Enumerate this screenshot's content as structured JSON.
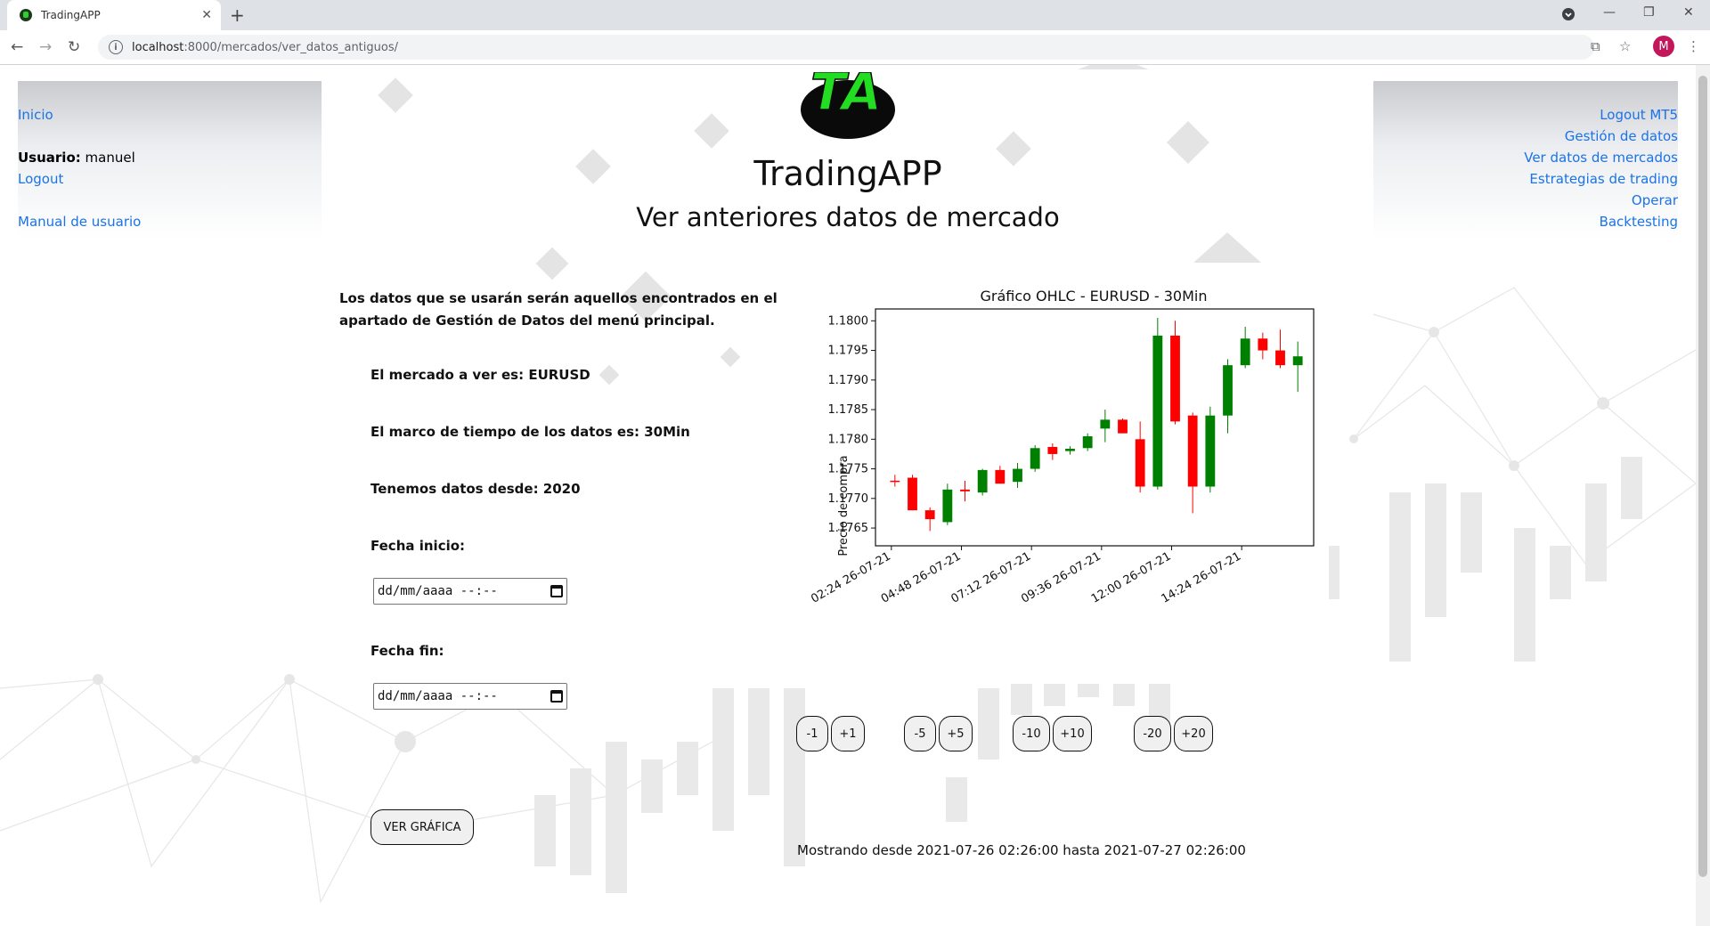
{
  "browser": {
    "tab_title": "TradingAPP",
    "url_host": "localhost",
    "url_path": ":8000/mercados/ver_datos_antiguos/",
    "profile_initial": "M"
  },
  "left_nav": {
    "inicio": "Inicio",
    "user_label": "Usuario:",
    "user_name": "manuel",
    "logout": "Logout",
    "manual": "Manual de usuario"
  },
  "right_nav": [
    "Logout MT5",
    "Gestión de datos",
    "Ver datos de mercados",
    "Estrategias de trading",
    "Operar",
    "Backtesting"
  ],
  "logo_text": "TA",
  "app_title": "TradingAPP",
  "page_title": "Ver anteriores datos de mercado",
  "description": "Los datos que se usarán serán aquellos encontrados en el apartado de Gestión de Datos del menú principal.",
  "info": {
    "market": "El mercado a ver es: EURUSD",
    "timeframe": "El marco de tiempo de los datos es: 30Min",
    "since": "Tenemos datos desde: 2020",
    "start_label": "Fecha inicio:",
    "end_label": "Fecha fin:",
    "date_placeholder": "dd/mm/aaaa --:--"
  },
  "buttons": {
    "m1": "-1",
    "p1": "+1",
    "m5": "-5",
    "p5": "+5",
    "m10": "-10",
    "p10": "+10",
    "m20": "-20",
    "p20": "+20",
    "view_chart": "VER GRÁFICA"
  },
  "status_text": "Mostrando desde 2021-07-26 02:26:00 hasta 2021-07-27 02:26:00",
  "colors": {
    "link": "#1a73e8",
    "up": "#008000",
    "down": "#ff0000",
    "logo_green": "#22dd22"
  },
  "chart_data": {
    "type": "candlestick",
    "title": "Gráfico OHLC - EURUSD - 30Min",
    "ylabel": "Precio de compra",
    "xlabel": "",
    "ylim": [
      1.1762,
      1.1802
    ],
    "y_ticks": [
      1.1765,
      1.177,
      1.1775,
      1.178,
      1.1785,
      1.179,
      1.1795,
      1.18
    ],
    "x_ticks": [
      "02:24  26-07-21",
      "04:48  26-07-21",
      "07:12  26-07-21",
      "09:36  26-07-21",
      "12:00  26-07-21",
      "14:24  26-07-21"
    ],
    "candles": [
      {
        "o": 1.1773,
        "h": 1.1774,
        "l": 1.1772,
        "c": 1.17728
      },
      {
        "o": 1.17735,
        "h": 1.1774,
        "l": 1.1768,
        "c": 1.1768
      },
      {
        "o": 1.1768,
        "h": 1.17685,
        "l": 1.17645,
        "c": 1.17665
      },
      {
        "o": 1.1766,
        "h": 1.17725,
        "l": 1.17655,
        "c": 1.17715
      },
      {
        "o": 1.17715,
        "h": 1.1773,
        "l": 1.17695,
        "c": 1.17712
      },
      {
        "o": 1.1771,
        "h": 1.1775,
        "l": 1.17705,
        "c": 1.17748
      },
      {
        "o": 1.17748,
        "h": 1.17755,
        "l": 1.17725,
        "c": 1.17725
      },
      {
        "o": 1.17728,
        "h": 1.1776,
        "l": 1.17718,
        "c": 1.1775
      },
      {
        "o": 1.1775,
        "h": 1.1779,
        "l": 1.17745,
        "c": 1.17785
      },
      {
        "o": 1.17787,
        "h": 1.17793,
        "l": 1.17765,
        "c": 1.17775
      },
      {
        "o": 1.1778,
        "h": 1.17788,
        "l": 1.17774,
        "c": 1.17784
      },
      {
        "o": 1.17785,
        "h": 1.1781,
        "l": 1.1778,
        "c": 1.17805
      },
      {
        "o": 1.17818,
        "h": 1.1785,
        "l": 1.17795,
        "c": 1.17833
      },
      {
        "o": 1.17833,
        "h": 1.17835,
        "l": 1.1781,
        "c": 1.1781
      },
      {
        "o": 1.178,
        "h": 1.1783,
        "l": 1.1771,
        "c": 1.1772
      },
      {
        "o": 1.1772,
        "h": 1.18005,
        "l": 1.17715,
        "c": 1.17975
      },
      {
        "o": 1.17975,
        "h": 1.18,
        "l": 1.17825,
        "c": 1.1783
      },
      {
        "o": 1.1784,
        "h": 1.17845,
        "l": 1.17675,
        "c": 1.1772
      },
      {
        "o": 1.1772,
        "h": 1.17855,
        "l": 1.1771,
        "c": 1.1784
      },
      {
        "o": 1.1784,
        "h": 1.17935,
        "l": 1.1781,
        "c": 1.17925
      },
      {
        "o": 1.17925,
        "h": 1.1799,
        "l": 1.1792,
        "c": 1.1797
      },
      {
        "o": 1.1797,
        "h": 1.1798,
        "l": 1.17935,
        "c": 1.1795
      },
      {
        "o": 1.1795,
        "h": 1.17985,
        "l": 1.1792,
        "c": 1.17925
      },
      {
        "o": 1.17925,
        "h": 1.17965,
        "l": 1.1788,
        "c": 1.1794
      }
    ]
  }
}
